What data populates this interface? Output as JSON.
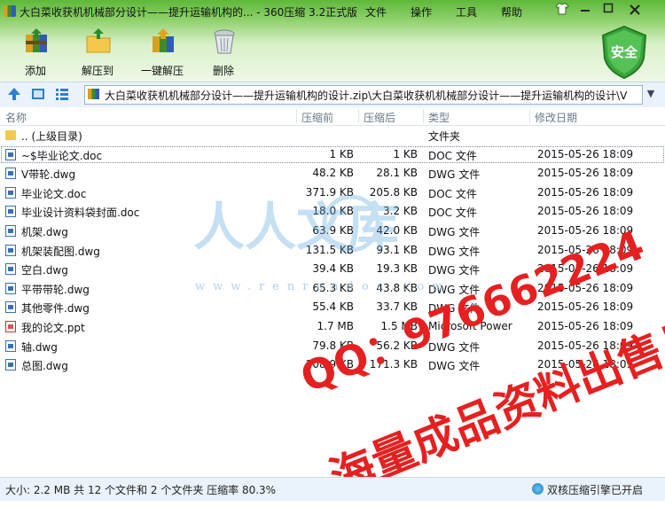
{
  "window": {
    "title": "大白菜收获机机械部分设计——提升运输机构的... - 360压缩 3.2正式版",
    "menu": [
      "文件",
      "操作",
      "工具",
      "帮助"
    ]
  },
  "toolbar": {
    "add": "添加",
    "extract": "解压到",
    "oneclick": "一键解压",
    "delete": "删除",
    "security": "安全"
  },
  "address": {
    "path": "大白菜收获机机械部分设计——提升运输机构的设计.zip\\大白菜收获机机械部分设计——提升运输机构的设计\\V"
  },
  "columns": {
    "name": "名称",
    "packed": "压缩前",
    "size": "压缩后",
    "type": "类型",
    "date": "修改日期"
  },
  "files": [
    {
      "name": ".. (上级目录)",
      "packed": "",
      "size": "",
      "type": "文件夹",
      "date": "",
      "icon": "folder-icon"
    },
    {
      "name": "~$毕业论文.doc",
      "packed": "1 KB",
      "size": "1 KB",
      "type": "DOC 文件",
      "date": "2015-05-26 18:09",
      "icon": "doc-file-icon"
    },
    {
      "name": "V带轮.dwg",
      "packed": "48.2 KB",
      "size": "28.1 KB",
      "type": "DWG 文件",
      "date": "2015-05-26 18:09",
      "icon": "dwg-file-icon"
    },
    {
      "name": "毕业论文.doc",
      "packed": "371.9 KB",
      "size": "205.8 KB",
      "type": "DOC 文件",
      "date": "2015-05-26 18:09",
      "icon": "doc-file-icon"
    },
    {
      "name": "毕业设计资料袋封面.doc",
      "packed": "18.0 KB",
      "size": "3.2 KB",
      "type": "DOC 文件",
      "date": "2015-05-26 18:09",
      "icon": "doc-file-icon"
    },
    {
      "name": "机架.dwg",
      "packed": "63.9 KB",
      "size": "42.0 KB",
      "type": "DWG 文件",
      "date": "2015-05-26 18:09",
      "icon": "dwg-file-icon"
    },
    {
      "name": "机架装配图.dwg",
      "packed": "131.5 KB",
      "size": "93.1 KB",
      "type": "DWG 文件",
      "date": "2015-05-26 18:09",
      "icon": "dwg-file-icon"
    },
    {
      "name": "空白.dwg",
      "packed": "39.4 KB",
      "size": "19.3 KB",
      "type": "DWG 文件",
      "date": "2015-05-26 18:09",
      "icon": "dwg-file-icon"
    },
    {
      "name": "平带带轮.dwg",
      "packed": "65.3 KB",
      "size": "43.8 KB",
      "type": "DWG 文件",
      "date": "2015-05-26 18:09",
      "icon": "dwg-file-icon"
    },
    {
      "name": "其他零件.dwg",
      "packed": "55.4 KB",
      "size": "33.7 KB",
      "type": "DWG 文件",
      "date": "2015-05-26 18:09",
      "icon": "dwg-file-icon"
    },
    {
      "name": "我的论文.ppt",
      "packed": "1.7 MB",
      "size": "1.5 MB",
      "type": "Microsoft Power",
      "date": "2015-05-26 18:09",
      "icon": "ppt-file-icon"
    },
    {
      "name": "轴.dwg",
      "packed": "79.8 KB",
      "size": "56.2 KB",
      "type": "DWG 文件",
      "date": "2015-05-26 18:09",
      "icon": "dwg-file-icon"
    },
    {
      "name": "总图.dwg",
      "packed": "208.9 KB",
      "size": "171.3 KB",
      "type": "DWG 文件",
      "date": "2015-05-26 18:09",
      "icon": "dwg-file-icon"
    }
  ],
  "watermark": {
    "logo_text": "人人文库",
    "url": "www.renrendoc.com",
    "qq": "QQ：976662224",
    "ad": "海量成品资料出售！"
  },
  "status": {
    "summary": "大小: 2.2 MB 共 12 个文件和 2 个文件夹 压缩率 80.3%",
    "engine": "双核压缩引擎已开启"
  }
}
